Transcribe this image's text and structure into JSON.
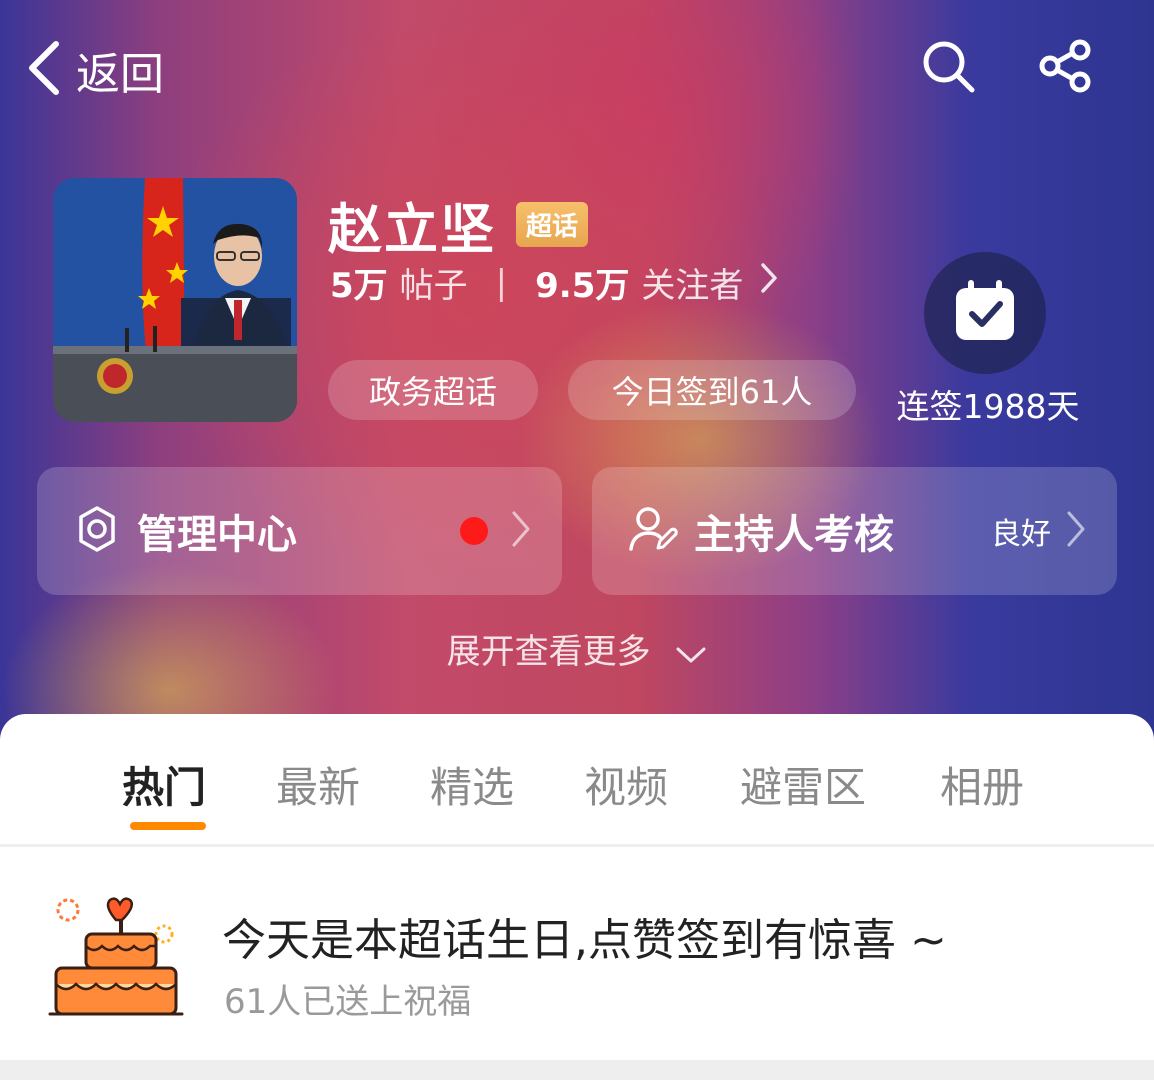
{
  "nav": {
    "back_label": "返回",
    "icons": [
      "search-icon",
      "share-icon"
    ]
  },
  "topic": {
    "title": "赵立坚",
    "badge": "超话",
    "posts_count": "5万",
    "posts_label": "帖子",
    "followers_count": "9.5万",
    "followers_label": "关注者",
    "tags": [
      "政务超话",
      "今日签到61人"
    ],
    "streak": "连签1988天"
  },
  "cards": {
    "manage": {
      "label": "管理中心",
      "has_notification": true
    },
    "host": {
      "label": "主持人考核",
      "status": "良好"
    }
  },
  "expand_label": "展开查看更多",
  "tabs": [
    {
      "label": "热门",
      "active": true
    },
    {
      "label": "最新",
      "active": false
    },
    {
      "label": "精选",
      "active": false
    },
    {
      "label": "视频",
      "active": false
    },
    {
      "label": "避雷区",
      "active": false
    },
    {
      "label": "相册",
      "active": false
    }
  ],
  "notice": {
    "title": "今天是本超话生日,点赞签到有惊喜 ~",
    "subtitle": "61人已送上祝福"
  },
  "colors": {
    "accent": "#ff8a00",
    "badge": "#e9a652",
    "notification_dot": "#ff1a1a"
  }
}
